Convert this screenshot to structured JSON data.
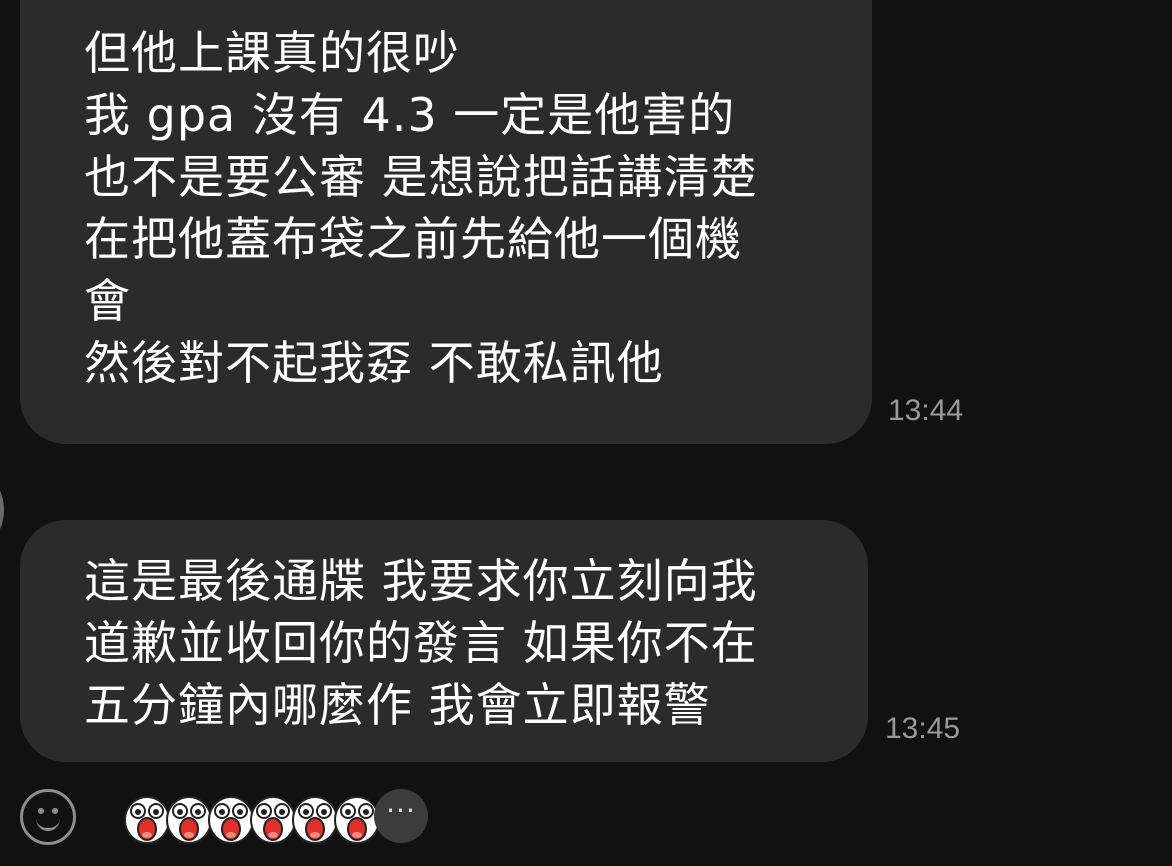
{
  "messages": [
    {
      "lines": [
        "但他上課真的很吵",
        "我 gpa 沒有 4.3 一定是他害的",
        "也不是要公審 是想說把話講清楚",
        "在把他蓋布袋之前先給他一個機",
        "會",
        "然後對不起我孬 不敢私訊他"
      ],
      "time": "13:44"
    },
    {
      "lines": [
        "這是最後通牒 我要求你立刻向我",
        "道歉並收回你的發言 如果你不在",
        "五分鐘內哪麼作 我會立即報警"
      ],
      "time": "13:45"
    }
  ],
  "input_bar": {
    "emoji_icon": "smiley-icon",
    "stickers": [
      "shocked-face-sticker",
      "shocked-face-sticker",
      "shocked-face-sticker",
      "shocked-face-sticker",
      "shocked-face-sticker",
      "shocked-face-sticker"
    ],
    "more_label": "···"
  },
  "colors": {
    "background": "#111111",
    "bubble": "#2b2b2b",
    "text": "#ffffff",
    "timestamp": "#9a9a9a"
  }
}
